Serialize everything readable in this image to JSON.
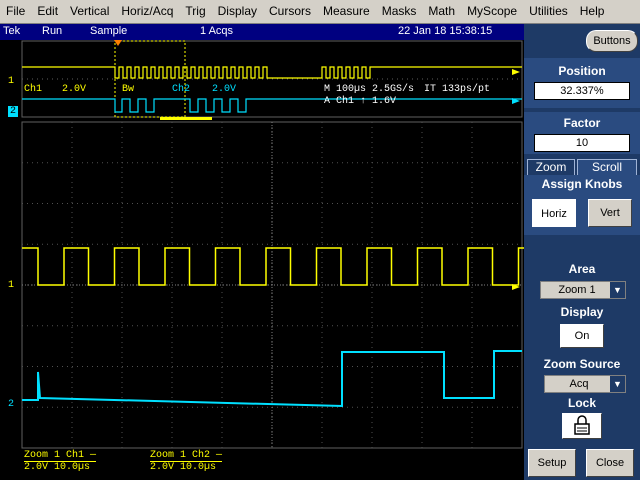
{
  "menu": [
    "File",
    "Edit",
    "Vertical",
    "Horiz/Acq",
    "Trig",
    "Display",
    "Cursors",
    "Measure",
    "Masks",
    "Math",
    "MyScope",
    "Utilities",
    "Help"
  ],
  "status": {
    "brand": "Tek",
    "run": "Run",
    "mode": "Sample",
    "acqs": "1 Acqs",
    "datetime": "22 Jan 18 15:38:15"
  },
  "buttons_label": "Buttons",
  "overview": {
    "ch1_label": "Ch1",
    "ch1_scale": "2.0V",
    "bw": "Bw",
    "ch2_label": "Ch2",
    "ch2_scale": "2.0V",
    "timebase": "M 100µs 2.5GS/s",
    "interval": "IT 133ps/pt",
    "trigger": "A  Ch1  ↑  1.6V"
  },
  "markers": {
    "ch1": "1",
    "ch2": "2"
  },
  "panel": {
    "position_title": "Position",
    "position_value": "32.337%",
    "factor_title": "Factor",
    "factor_value": "10",
    "tab_zoom": "Zoom",
    "tab_scroll": "Scroll",
    "assign_knobs": "Assign Knobs",
    "horiz": "Horiz",
    "vert": "Vert",
    "area_title": "Area",
    "area_value": "Zoom 1",
    "display_title": "Display",
    "display_value": "On",
    "zoom_source_title": "Zoom Source",
    "zoom_source_value": "Acq",
    "lock_title": "Lock",
    "setup": "Setup",
    "close": "Close"
  },
  "readouts": {
    "z1_ch1_title": "Zoom 1   Ch1 —",
    "z1_ch1_vals": "2.0V      10.0µs",
    "z1_ch2_title": "Zoom 1   Ch2 —",
    "z1_ch2_vals": "2.0V      10.0µs"
  },
  "colors": {
    "ch1": "#ffff00",
    "ch2": "#00e0ff",
    "panel_bg": "#1e3a66",
    "statusbar": "#000080"
  }
}
